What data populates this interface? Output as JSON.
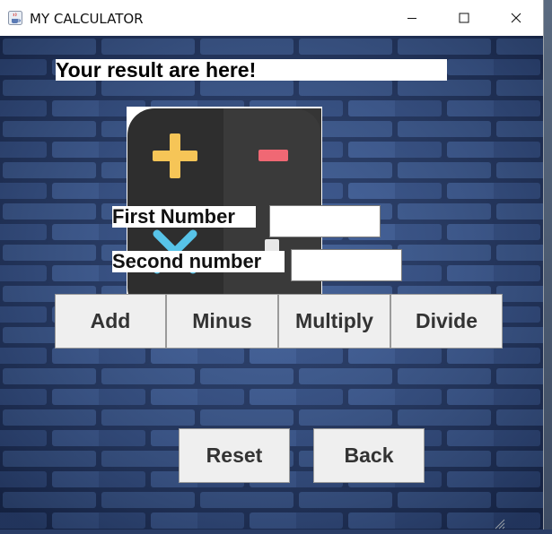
{
  "window": {
    "title": "MY CALCULATOR",
    "icons": {
      "app": "java-cup-icon",
      "minimize": "minimize-icon",
      "maximize": "maximize-icon",
      "close": "close-icon"
    }
  },
  "result": {
    "text": "Your result are here!"
  },
  "form": {
    "first_label": "First Number",
    "first_value": "",
    "second_label": "Second number",
    "second_value": ""
  },
  "operations": {
    "add": "Add",
    "minus": "Minus",
    "multiply": "Multiply",
    "divide": "Divide"
  },
  "actions": {
    "reset": "Reset",
    "back": "Back"
  },
  "colors": {
    "plus": "#f6c557",
    "minus": "#f06874",
    "times": "#57c3e8",
    "calc_body": "#2e2e2e"
  }
}
